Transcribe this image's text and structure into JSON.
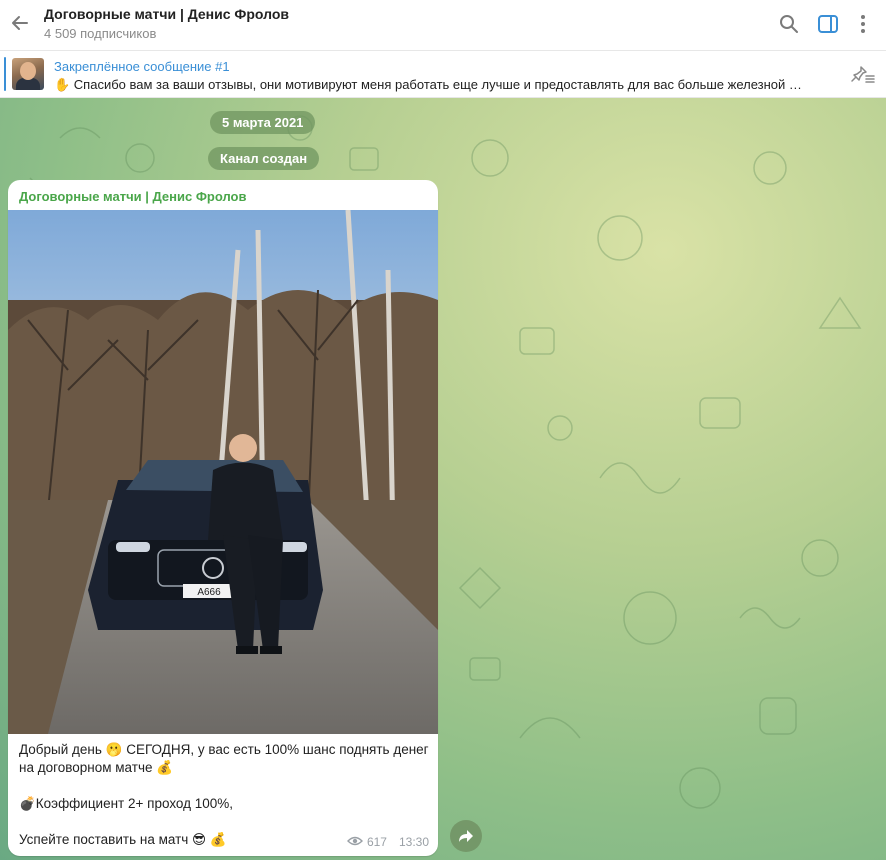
{
  "header": {
    "title": "Договорные матчи | Денис Фролов",
    "subscribers": "4 509 подписчиков",
    "icons": [
      "back-arrow-icon",
      "search-icon",
      "sidebar-toggle-icon",
      "more-vertical-icon"
    ],
    "accent_color": "#3a8fd6"
  },
  "pinned": {
    "title": "Закреплённое сообщение #1",
    "text": "✋ Спасибо вам за ваши отзывы, они мотивируют меня работать еще лучше и предоставлять для вас больше железной …",
    "action_icon": "unpin-icon"
  },
  "chat": {
    "date_label": "5 марта 2021",
    "service_message": "Канал создан",
    "message": {
      "sender": "Договорные матчи | Денис Фролов",
      "sender_color": "#4aa64a",
      "lines": [
        "Добрый день 🫢 СЕГОДНЯ, у вас есть 100% шанс поднять денег на договорном матче 💰",
        "💣Коэффициент 2+ проход 100%,",
        "Успейте поставить на матч 😎 💰"
      ],
      "views": "617",
      "time": "13:30",
      "plate": "A666"
    },
    "forward_icon": "forward-arrow-icon"
  }
}
